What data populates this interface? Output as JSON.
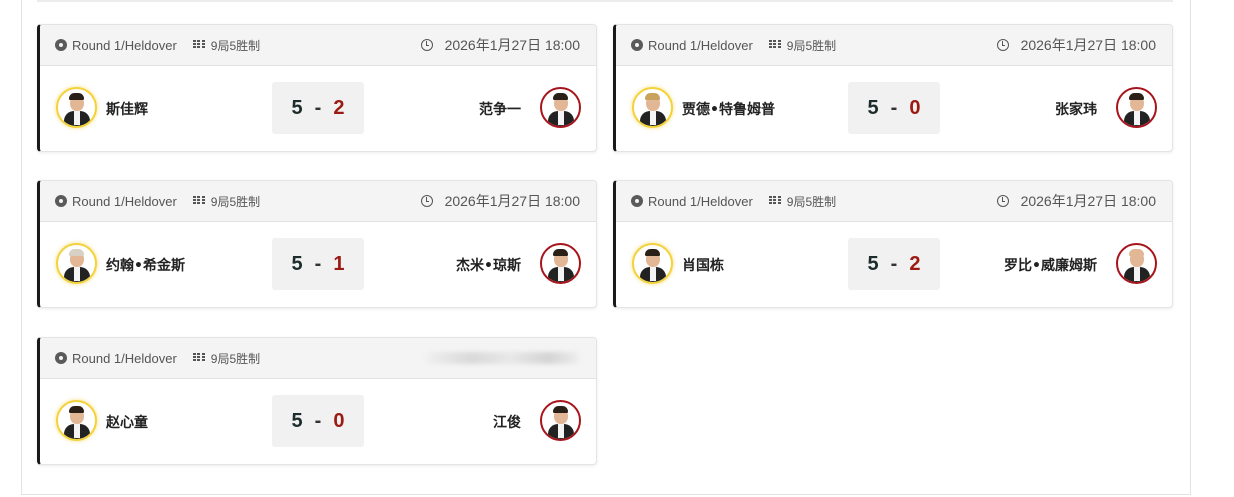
{
  "matches": [
    {
      "round": "Round 1/Heldover",
      "format": "9局5胜制",
      "time": "2026年1月27日 18:00",
      "player1": {
        "name": "斯佳辉",
        "score": "5"
      },
      "player2": {
        "name": "范争一",
        "score": "2"
      },
      "separator": "-"
    },
    {
      "round": "Round 1/Heldover",
      "format": "9局5胜制",
      "time": "2026年1月27日 18:00",
      "player1": {
        "name": "贾德•特鲁姆普",
        "score": "5"
      },
      "player2": {
        "name": "张家玮",
        "score": "0"
      },
      "separator": "-"
    },
    {
      "round": "Round 1/Heldover",
      "format": "9局5胜制",
      "time": "2026年1月27日 18:00",
      "player1": {
        "name": "约翰•希金斯",
        "score": "5"
      },
      "player2": {
        "name": "杰米•琼斯",
        "score": "1"
      },
      "separator": "-"
    },
    {
      "round": "Round 1/Heldover",
      "format": "9局5胜制",
      "time": "2026年1月27日 18:00",
      "player1": {
        "name": "肖国栋",
        "score": "5"
      },
      "player2": {
        "name": "罗比•威廉姆斯",
        "score": "2"
      },
      "separator": "-"
    },
    {
      "round": "Round 1/Heldover",
      "format": "9局5胜制",
      "time": "",
      "player1": {
        "name": "赵心童",
        "score": "5"
      },
      "player2": {
        "name": "江俊",
        "score": "0"
      },
      "separator": "-"
    }
  ],
  "icons": {
    "round": "round-dot-icon",
    "format": "grid-icon",
    "time": "clock-icon",
    "winner_ring_color": "#f3d23c",
    "loser_ring_color": "#a8141b"
  },
  "colors": {
    "winner_score": "#1c2b2b",
    "loser_score": "#9b1a12",
    "card_accent": "#1a1a1a"
  }
}
